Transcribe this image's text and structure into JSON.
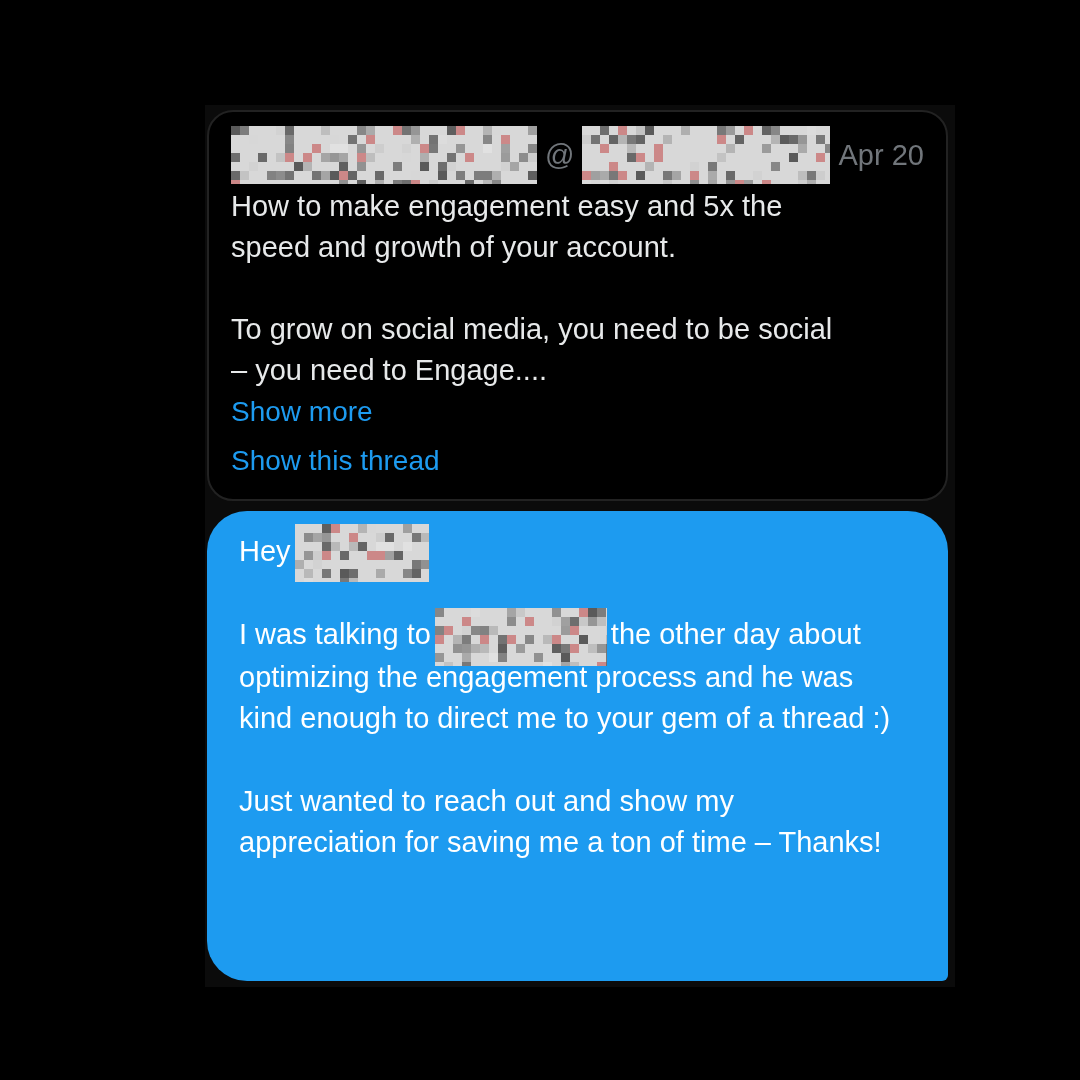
{
  "tweet": {
    "header": [
      {
        "kind": "redacted"
      },
      {
        "kind": "at",
        "text": "@"
      },
      {
        "kind": "redacted"
      },
      {
        "kind": "date",
        "text": "Apr 20"
      }
    ],
    "paragraphs": [
      "How to make engagement easy and 5x the speed and growth of your account.",
      "To grow on social media, you need to be social – you need to Engage...."
    ],
    "links": [
      "Show more",
      "Show this thread"
    ]
  },
  "message": {
    "paragraphs": [
      [
        {
          "kind": "text",
          "text": "Hey"
        },
        {
          "kind": "redacted"
        }
      ],
      [
        {
          "kind": "text",
          "text": "I was talking to"
        },
        {
          "kind": "redacted"
        },
        {
          "kind": "text",
          "text": "the other day about"
        },
        {
          "kind": "block",
          "text": "optimizing the engagement process and he was kind enough to direct me to your gem of a thread :)"
        }
      ],
      [
        {
          "kind": "block",
          "text": "Just wanted to reach out and show my appreciation for saving me a ton of time – Thanks!"
        }
      ]
    ]
  }
}
